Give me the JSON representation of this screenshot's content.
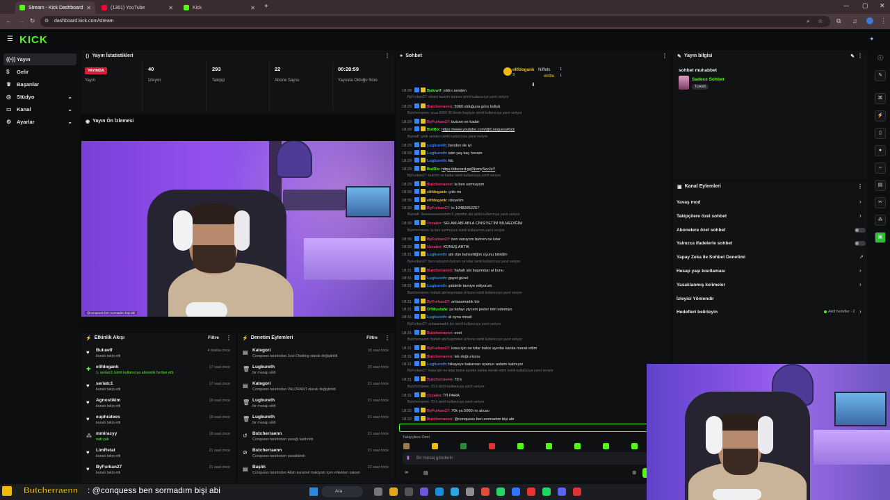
{
  "browser": {
    "tabs": [
      {
        "title": "Stream - Kick Dashboard",
        "active": true,
        "color": "#53fc18"
      },
      {
        "title": "(1361) YouTube",
        "active": false,
        "color": "#ff0033"
      },
      {
        "title": "Kick",
        "active": false,
        "color": "#53fc18"
      }
    ],
    "url": "dashboard.kick.com/stream"
  },
  "brand": {
    "logo": "KICK",
    "accent": "#53fc18"
  },
  "sidebar": [
    {
      "label": "Yayın",
      "icon": "broadcast-icon",
      "active": true,
      "chevron": false
    },
    {
      "label": "Gelir",
      "icon": "money-icon",
      "active": false,
      "chevron": false
    },
    {
      "label": "Başarılar",
      "icon": "trophy-icon",
      "active": false,
      "chevron": false
    },
    {
      "label": "Stüdyo",
      "icon": "studio-icon",
      "active": false,
      "chevron": true
    },
    {
      "label": "Kanal",
      "icon": "channel-icon",
      "active": false,
      "chevron": true
    },
    {
      "label": "Ayarlar",
      "icon": "settings-icon",
      "active": false,
      "chevron": true
    }
  ],
  "stats": {
    "title": "Yayın İstatistikleri",
    "live_badge": "YAYINDA",
    "stream_label": "Yayın",
    "items": [
      {
        "value": "40",
        "label": "İzleyici"
      },
      {
        "value": "293",
        "label": "Takipçi"
      },
      {
        "value": "22",
        "label": "Abone Sayısı"
      },
      {
        "value": "00:28:59",
        "label": "Yayında Olduğu Süre"
      }
    ]
  },
  "preview": {
    "title": "Yayın Ön İzlemesi",
    "caption": "@conqeuss ben sormadım bişi abi"
  },
  "activity": {
    "title": "Etkinlik Akışı",
    "filter": "Filtre",
    "items": [
      {
        "icon": "heart-icon",
        "name": "Buluwlf",
        "sub": "kanalı takip etti",
        "time": "4 dakika önce",
        "subcolor": "#aaaaaa"
      },
      {
        "icon": "gift-icon",
        "name": "elifdogank",
        "sub": "1, seriatc1 isimli kullanıcıya abonelik hediye etti.",
        "time": "17 saat önce",
        "subcolor": "#53fc18"
      },
      {
        "icon": "heart-icon",
        "name": "seriatc1",
        "sub": "kanalı takip etti",
        "time": "17 saat önce",
        "subcolor": "#aaaaaa"
      },
      {
        "icon": "heart-icon",
        "name": "Agnostikim",
        "sub": "kanalı takip etti",
        "time": "19 saat önce",
        "subcolor": "#aaaaaa"
      },
      {
        "icon": "heart-icon",
        "name": "euphratees",
        "sub": "kanalı takip etti",
        "time": "19 saat önce",
        "subcolor": "#aaaaaa"
      },
      {
        "icon": "raid-icon",
        "name": "mmiracyy",
        "sub": "nah çek",
        "time": "19 saat önce",
        "subcolor": "#53fc18"
      },
      {
        "icon": "heart-icon",
        "name": "LimRetat",
        "sub": "kanalı takip etti",
        "time": "21 saat önce",
        "subcolor": "#aaaaaa"
      },
      {
        "icon": "heart-icon",
        "name": "ByFurkan27",
        "sub": "kanalı takip etti",
        "time": "21 saat önce",
        "subcolor": "#aaaaaa"
      }
    ]
  },
  "modlog": {
    "title": "Denetim Eylemleri",
    "filter": "Filtre",
    "items": [
      {
        "icon": "category-icon",
        "name": "Kategori",
        "sub": "Conquess tarafından Just Chatting olarak değiştirildi",
        "time": "18 saat önce"
      },
      {
        "icon": "trash-icon",
        "name": "Lugbureth",
        "sub": "bir mesajı sildi",
        "time": "20 saat önce"
      },
      {
        "icon": "category-icon",
        "name": "Kategori",
        "sub": "Conquess tarafından VALORANT olarak değiştirildi",
        "time": "21 saat önce"
      },
      {
        "icon": "trash-icon",
        "name": "Lugbureth",
        "sub": "bir mesajı sildi",
        "time": "21 saat önce"
      },
      {
        "icon": "trash-icon",
        "name": "Lugbureth",
        "sub": "bir mesajı sildi",
        "time": "21 saat önce"
      },
      {
        "icon": "unban-icon",
        "name": "Butcherraenn",
        "sub": "Conquess tarafından yasağı kaldırıldı",
        "time": "21 saat önce"
      },
      {
        "icon": "ban-icon",
        "name": "Butcherraenn",
        "sub": "Conquess tarafından yasaklandı",
        "time": "21 saat önce"
      },
      {
        "icon": "title-icon",
        "name": "Başlık",
        "sub": "Conquess tarafından Allah karamel makiyato içen erkekten saksın",
        "time": "22 saat önce"
      }
    ]
  },
  "chat": {
    "title": "Sohbet",
    "pinned": {
      "user1": "elifdogank",
      "count1": "3",
      "user2": "Niffels",
      "count2": "1",
      "user3": "ektbu",
      "count3": "1"
    },
    "lines": [
      {
        "time": "18:28",
        "user": "Buluwlf",
        "color": "#53fc18",
        "msg": "yıldırı senden",
        "reply": ""
      },
      {
        "time": "",
        "user": "",
        "color": "",
        "msg": "",
        "reply": "ByFurkan27: ekrani kartımı kartımı isimli kullanıcıya yanıt veriyor"
      },
      {
        "time": "18:29",
        "user": "Butcherraenn",
        "color": "#e23b6d",
        "msg": "5060 olduğuna göre koltuk",
        "reply": ""
      },
      {
        "time": "",
        "user": "",
        "color": "",
        "msg": "",
        "reply": "Butcherraenn: ucuz 5060 30 binde başlıyor isimli kullanıcıya yanıt veriyor"
      },
      {
        "time": "18:29",
        "user": "ByFurkan27",
        "color": "#e23b6d",
        "msg": "butcen ne kadar",
        "reply": ""
      },
      {
        "time": "18:29",
        "user": "BotRix",
        "color": "#53fc18",
        "msg": "https://www.youtube.com/@ConquessKick",
        "reply": ""
      },
      {
        "time": "",
        "user": "",
        "color": "",
        "msg": "",
        "reply": "Buluwlf: iyidir senden isimli kullanıcıya yanıt veriyor"
      },
      {
        "time": "18:29",
        "user": "Lugbureth",
        "color": "#3b82f6",
        "msg": "benden de iyi",
        "reply": ""
      },
      {
        "time": "18:29",
        "user": "Lugbureth",
        "color": "#3b82f6",
        "msg": "isim yaş kaç hocam",
        "reply": ""
      },
      {
        "time": "18:29",
        "user": "Lugbureth",
        "color": "#3b82f6",
        "msg": "fdc",
        "reply": ""
      },
      {
        "time": "18:29",
        "user": "BotRix",
        "color": "#53fc18",
        "msg": "https://discord.gg/NcmySzvJsY",
        "reply": ""
      },
      {
        "time": "",
        "user": "",
        "color": "",
        "msg": "",
        "reply": "ByFurkan27: butcen ne kadar isimli kullanıcıya yanıt veriyor"
      },
      {
        "time": "18:29",
        "user": "Butcherraenn",
        "color": "#e23b6d",
        "msg": "la ben sormuyom",
        "reply": ""
      },
      {
        "time": "18:30",
        "user": "elifdogank",
        "color": "#e8c21b",
        "msg": "çıktı mı",
        "reply": ""
      },
      {
        "time": "18:30",
        "user": "elifdogank",
        "color": "#e8c21b",
        "msg": "izleyelim",
        "reply": ""
      },
      {
        "time": "18:30",
        "user": "ByFurkan27",
        "color": "#e23b6d",
        "msg": "tc 19482852267",
        "reply": ""
      },
      {
        "time": "",
        "user": "",
        "color": "",
        "msg": "",
        "reply": "Buluwlf: Seeeeeeeeeeelam 0 yaşndar abi isimli kullanıcıya yanıt veriyor"
      },
      {
        "time": "18:30",
        "user": "Uzzalex",
        "color": "#e23b6d",
        "msg": "SELAM ABİ ABLA CİNSİYETİNİ BİLMEDİĞİM",
        "reply": ""
      },
      {
        "time": "",
        "user": "",
        "color": "",
        "msg": "",
        "reply": "Butcherraenn: la ben sormuyom isimli kullanıcıya yanıt veriyor"
      },
      {
        "time": "18:30",
        "user": "ByFurkan27",
        "color": "#e23b6d",
        "msg": "ben soruyom butcen ne kdar",
        "reply": ""
      },
      {
        "time": "18:30",
        "user": "Uzzalex",
        "color": "#e23b6d",
        "msg": "KONUŞ ARTIK",
        "reply": ""
      },
      {
        "time": "18:31",
        "user": "Lugbureth",
        "color": "#3b82f6",
        "msg": "abi dün bahsettiğim oyunu bitirdim",
        "reply": ""
      },
      {
        "time": "",
        "user": "",
        "color": "",
        "msg": "",
        "reply": "ByFurkan27: ben soruyom butcen ne kdar isimli kullanıcıya yanıt veriyor"
      },
      {
        "time": "18:31",
        "user": "Butcherraenn",
        "color": "#e23b6d",
        "msg": "hahah abi başımdan al bunu",
        "reply": ""
      },
      {
        "time": "18:31",
        "user": "Lugbureth",
        "color": "#3b82f6",
        "msg": "gayet güzel",
        "reply": ""
      },
      {
        "time": "18:31",
        "user": "Lugbureth",
        "color": "#3b82f6",
        "msg": "şiddetle tavsiye ediyorum",
        "reply": ""
      },
      {
        "time": "",
        "user": "",
        "color": "",
        "msg": "",
        "reply": "Butcherraenn: hahah abi başımdan al bunu isimli kullanıcıya yanıt veriyor"
      },
      {
        "time": "18:31",
        "user": "ByFurkan27",
        "color": "#e23b6d",
        "msg": "anlasamadık biz",
        "reply": ""
      },
      {
        "time": "18:31",
        "user": "OTMustafa",
        "color": "#53fc18",
        "msg": "ya kafayı yiycem peder intri odemiyo",
        "reply": ""
      },
      {
        "time": "18:31",
        "user": "Lugbureth",
        "color": "#3b82f6",
        "msg": "al oyna misali",
        "reply": ""
      },
      {
        "time": "",
        "user": "",
        "color": "",
        "msg": "",
        "reply": "ByFurkan27: anlasamadık biz isimli kullanıcıya yanıt veriyor"
      },
      {
        "time": "18:31",
        "user": "Butcherraenn",
        "color": "#e23b6d",
        "msg": "evet",
        "reply": ""
      },
      {
        "time": "",
        "user": "",
        "color": "",
        "msg": "",
        "reply": "Butcherraenn: hahah abi başımdan al bunu isimli kullanıcıya yanıt veriyor"
      },
      {
        "time": "18:31",
        "user": "ByFurkan27",
        "color": "#e23b6d",
        "msg": "kasa için ne kdar butce ayırdın kanka merak ettim",
        "reply": ""
      },
      {
        "time": "18:31",
        "user": "Butcherraenn",
        "color": "#e23b6d",
        "msg": "tek doğru konu",
        "reply": ""
      },
      {
        "time": "18:31",
        "user": "Lugbureth",
        "color": "#3b82f6",
        "msg": "hikayeye bakarsan oyunun anlamı kalmıyor",
        "reply": ""
      },
      {
        "time": "",
        "user": "",
        "color": "",
        "msg": "",
        "reply": "ByFurkan27: kasa için ne kdar butce ayırdın kanka merak ettim isimli kullanıcıya yanıt veriyor"
      },
      {
        "time": "18:31",
        "user": "Butcherraenn",
        "color": "#e23b6d",
        "msg": "70 k",
        "reply": ""
      },
      {
        "time": "",
        "user": "",
        "color": "",
        "msg": "",
        "reply": "Butcherraenn: 70 k isimli kullanıcıya yanıt veriyor"
      },
      {
        "time": "18:31",
        "user": "Uzzalex",
        "color": "#e23b6d",
        "msg": "İYİ PARA",
        "reply": ""
      },
      {
        "time": "",
        "user": "",
        "color": "",
        "msg": "",
        "reply": "Butcherraenn: 70 k isimli kullanıcıya yanıt veriyor"
      },
      {
        "time": "18:32",
        "user": "ByFurkan27",
        "color": "#e23b6d",
        "msg": "70k ya 5060 mı alıcan",
        "reply": ""
      },
      {
        "time": "18:32",
        "user": "Butcherraenn",
        "color": "#e23b6d",
        "msg": "@conquess ben sormadım bişi abi",
        "reply": ""
      }
    ],
    "follower_only": "Takipçilere Özel",
    "input_placeholder": "Bir mesaj gönderin"
  },
  "stream_info": {
    "title": "Yayın bilgisi",
    "stream_title": "sohbet muhabbet",
    "category": "Sadece Sohbet",
    "tag": "Turkish"
  },
  "channel_actions": {
    "title": "Kanal Eylemleri",
    "items": [
      {
        "label": "Yavaş mod",
        "control": "chevron"
      },
      {
        "label": "Takipçilere özel sohbet",
        "control": "chevron"
      },
      {
        "label": "Abonelere özel sohbet",
        "control": "toggle"
      },
      {
        "label": "Yalnızca ifadelerle sohbet",
        "control": "toggle"
      },
      {
        "label": "Yapay Zeka ile Sohbet Denetimi",
        "control": "external"
      },
      {
        "label": "Hesap yaşı kısıtlaması",
        "control": "chevron"
      },
      {
        "label": "Yasaklanmış kelimeler",
        "control": "chevron"
      },
      {
        "label": "İzleyici Yönlendir",
        "control": "none"
      },
      {
        "label": "Hedefleri belirleyin",
        "control": "goal"
      }
    ],
    "goal_status": "Aktif hedefler - 2"
  },
  "overlay_caption": {
    "user": "Butcherraenn",
    "msg": ": @conquess ben sormadım bişi abi"
  },
  "taskbar": {
    "search": "Ara"
  }
}
